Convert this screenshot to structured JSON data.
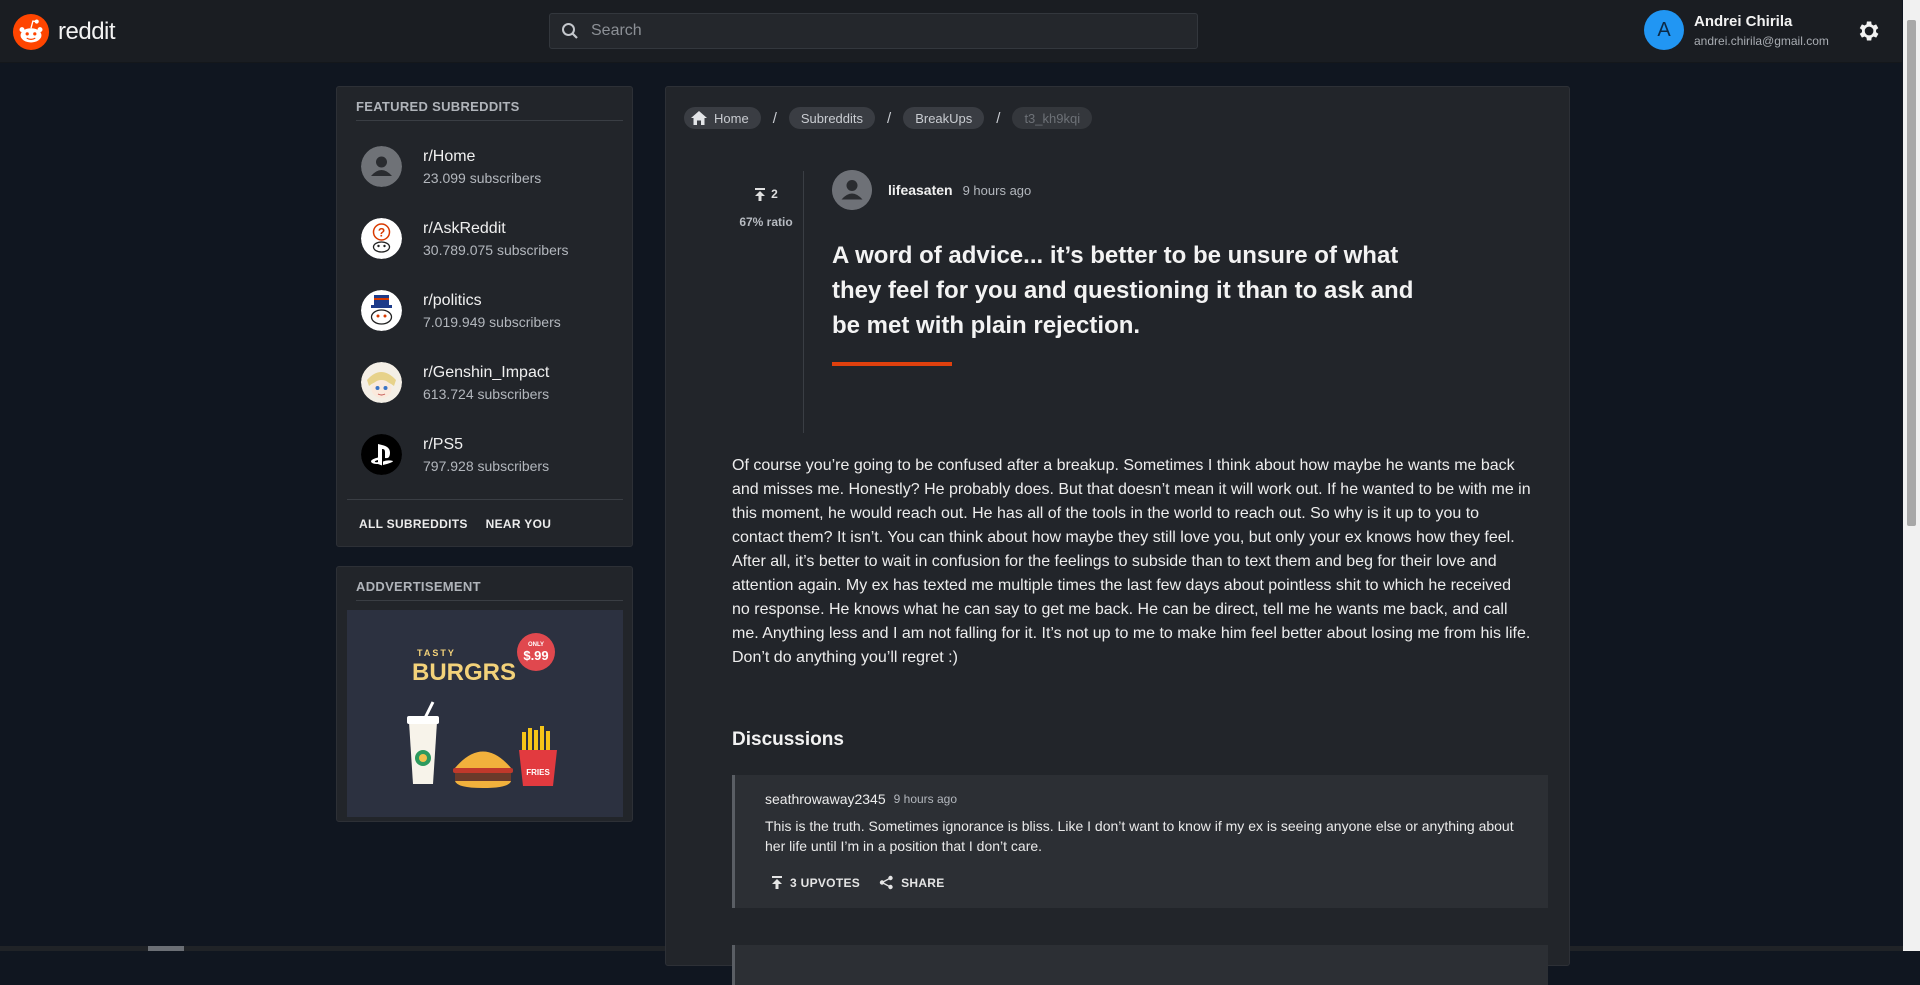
{
  "app": {
    "brand": "reddit",
    "brand_color": "#ff4500",
    "accent_color": "#e0400d"
  },
  "search": {
    "placeholder": "Search",
    "value": ""
  },
  "user": {
    "avatar_letter": "A",
    "name": "Andrei Chirila",
    "email": "andrei.chirila@gmail.com",
    "avatar_color": "#2196f3"
  },
  "icons": {
    "settings": "gear-icon",
    "search": "search-icon"
  },
  "sidebar": {
    "featured_title": "FEATURED SUBREDDITS",
    "subreddits": [
      {
        "name": "r/Home",
        "subscribers": "23.099 subscribers",
        "icon": "default-avatar-icon"
      },
      {
        "name": "r/AskReddit",
        "subscribers": "30.789.075 subscribers",
        "icon": "askreddit-icon"
      },
      {
        "name": "r/politics",
        "subscribers": "7.019.949 subscribers",
        "icon": "politics-icon"
      },
      {
        "name": "r/Genshin_Impact",
        "subscribers": "613.724 subscribers",
        "icon": "genshin-icon"
      },
      {
        "name": "r/PS5",
        "subscribers": "797.928 subscribers",
        "icon": "playstation-icon"
      }
    ],
    "links": [
      "ALL SUBREDDITS",
      "NEAR YOU"
    ],
    "ad_title": "ADDVERTISEMENT",
    "ad": {
      "brand_small": "TASTY",
      "brand": "BURGRS",
      "badge_top": "ONLY",
      "badge_price": "$.99",
      "fries_label": "FRIES"
    }
  },
  "breadcrumbs": [
    "Home",
    "Subreddits",
    "BreakUps",
    "t3_kh9kqi"
  ],
  "post": {
    "votes": "2",
    "ratio": "67% ratio",
    "author": "lifeasaten",
    "time": "9 hours ago",
    "title": "A word of advice... it’s better to be unsure of what they feel for you and questioning it than to ask and be met with plain rejection.",
    "body": "Of course you’re going to be confused after a breakup. Sometimes I think about how maybe he wants me back and misses me. Honestly? He probably does. But that doesn’t mean it will work out. If he wanted to be with me in this moment, he would reach out. He has all of the tools in the world to reach out. So why is it up to you to contact them? It isn’t. You can think about how maybe they still love you, but only your ex knows how they feel. After all, it’s better to wait in confusion for the feelings to subside than to text them and beg for their love and attention again. My ex has texted me multiple times the last few days about pointless shit to which he received no response. He knows what he can say to get me back. He can be direct, tell me he wants me back, and call me. Anything less and I am not falling for it. It’s not up to me to make him feel better about losing me from his life. Don’t do anything you’ll regret :)"
  },
  "discussions": {
    "heading": "Discussions",
    "comments": [
      {
        "author": "seathrowaway2345",
        "time": "9 hours ago",
        "body": "This is the truth. Sometimes ignorance is bliss. Like I don’t want to know if my ex is seeing anyone else or anything about her life until I’m in a position that I don’t care.",
        "upvotes_label": "3 UPVOTES",
        "share_label": "SHARE"
      }
    ]
  }
}
